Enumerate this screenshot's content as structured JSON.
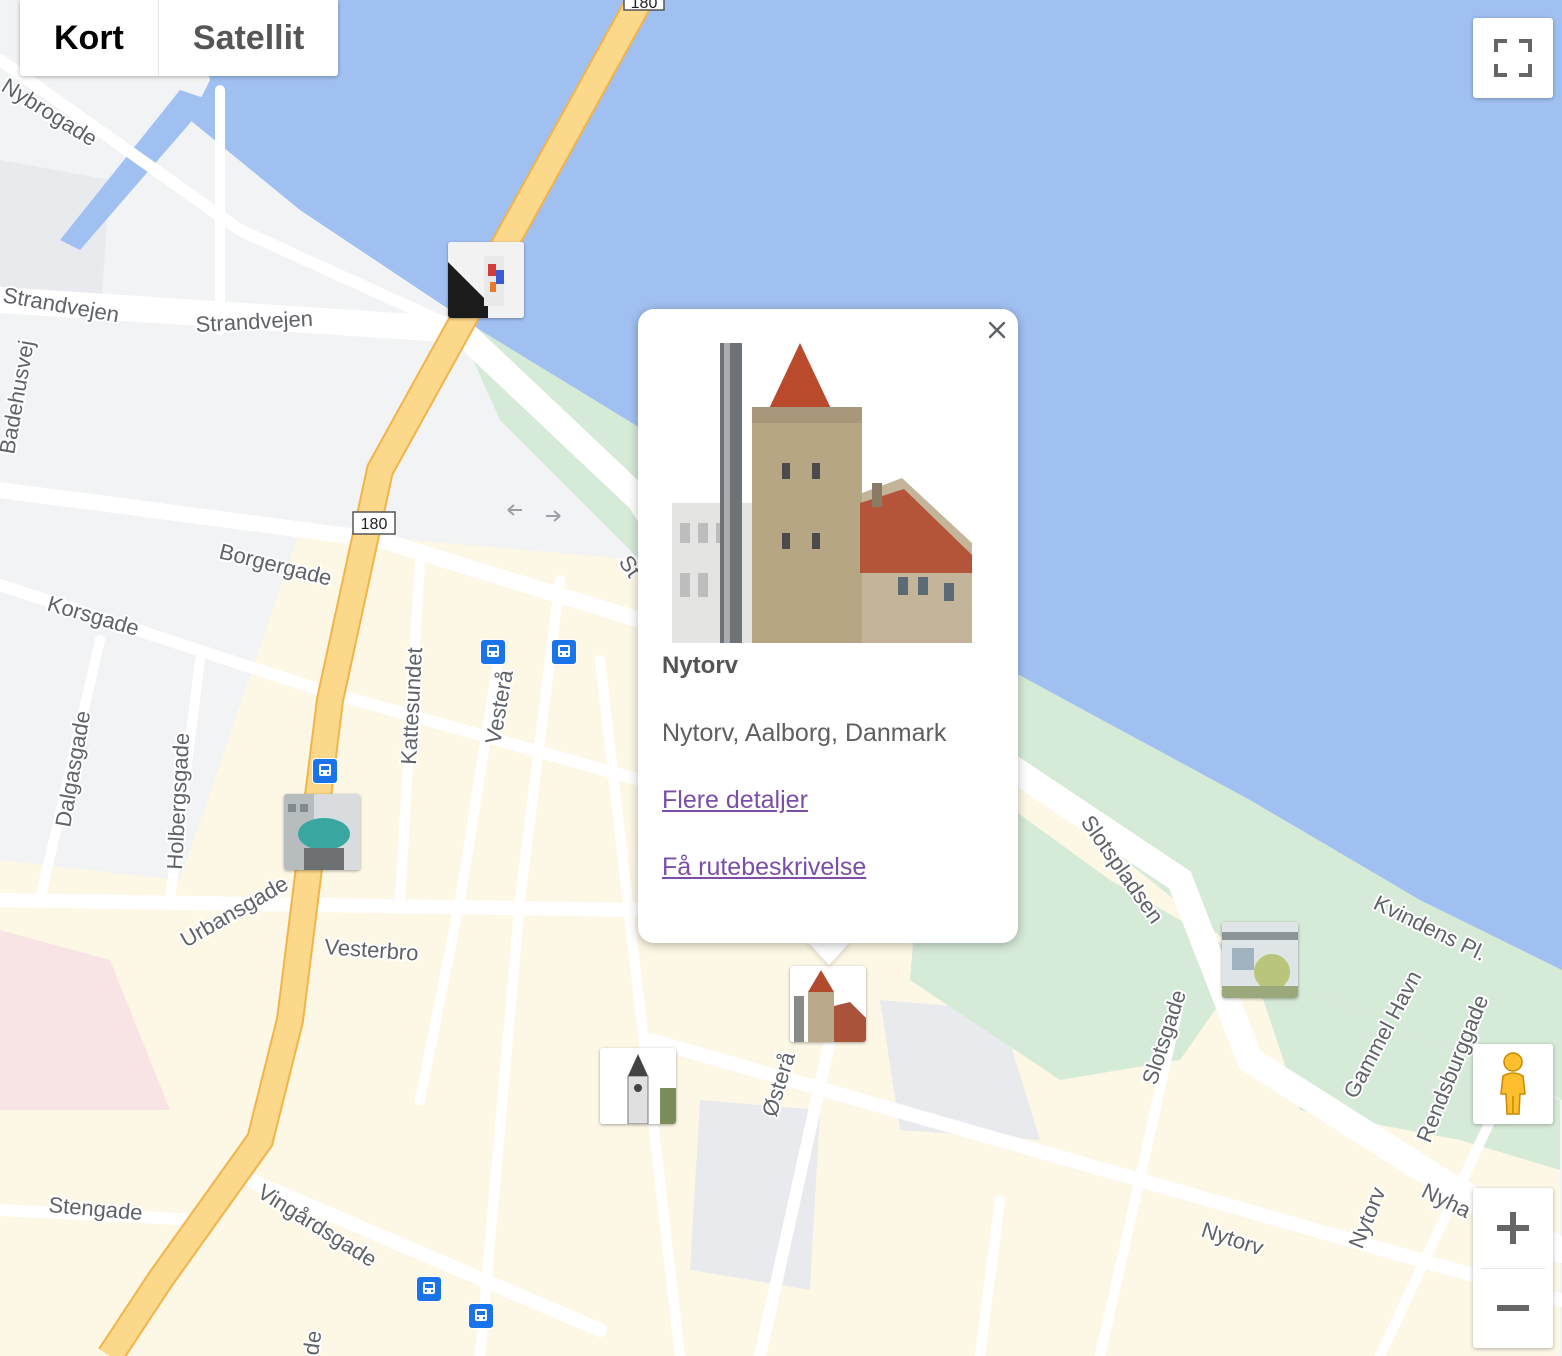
{
  "map_type": {
    "map_label": "Kort",
    "satellite_label": "Satellit"
  },
  "streets": {
    "nybrogade": "Nybrogade",
    "strandvejen_west": "Strandvejen",
    "strandvejen_east": "Strandvejen",
    "badehusvej": "Badehusvej",
    "borgergade": "Borgergade",
    "korsgade": "Korsgade",
    "kattesundet": "Kattesundet",
    "vestera": "Vesterå",
    "dalgasgade": "Dalgasgade",
    "holbergsgade": "Holbergsgade",
    "urbansgade": "Urbansgade",
    "vesterbro": "Vesterbro",
    "stengade": "Stengade",
    "vingardsgade": "Vingårdsgade",
    "ostera": "Østerå",
    "slotspladsen": "Slotspladsen",
    "slotsgade": "Slotsgade",
    "kvindens_pl": "Kvindens Pl.",
    "gammel_havn": "Gammel Havn",
    "rendsburggade": "Rendsburggade",
    "nyhavnsgade": "Nyha",
    "nytorv_street": "Nytorv",
    "nytorv_vertical": "Nytorv",
    "strand_partial": "St",
    "edge_de": "de"
  },
  "route_shields": {
    "top": "180",
    "middle": "180"
  },
  "infowindow": {
    "title": "Nytorv",
    "address": "Nytorv, Aalborg, Danmark",
    "details_link": "Flere detaljer",
    "directions_link": "Få rutebeskrivelse"
  },
  "icons": {
    "fullscreen": "fullscreen-icon",
    "street_view": "pegman-icon",
    "zoom_in": "plus-icon",
    "zoom_out": "minus-icon",
    "close": "close-icon",
    "bus": "bus-stop-icon"
  },
  "colors": {
    "water": "#a1c0f2",
    "land": "#f1f3f4",
    "urban": "#fdf8e6",
    "park": "#d6ead8",
    "major_road": "#fcd88b",
    "major_road_edge": "#f2b44a",
    "road": "#ffffff",
    "link": "#7b4eaa",
    "transit": "#1a73e8"
  }
}
